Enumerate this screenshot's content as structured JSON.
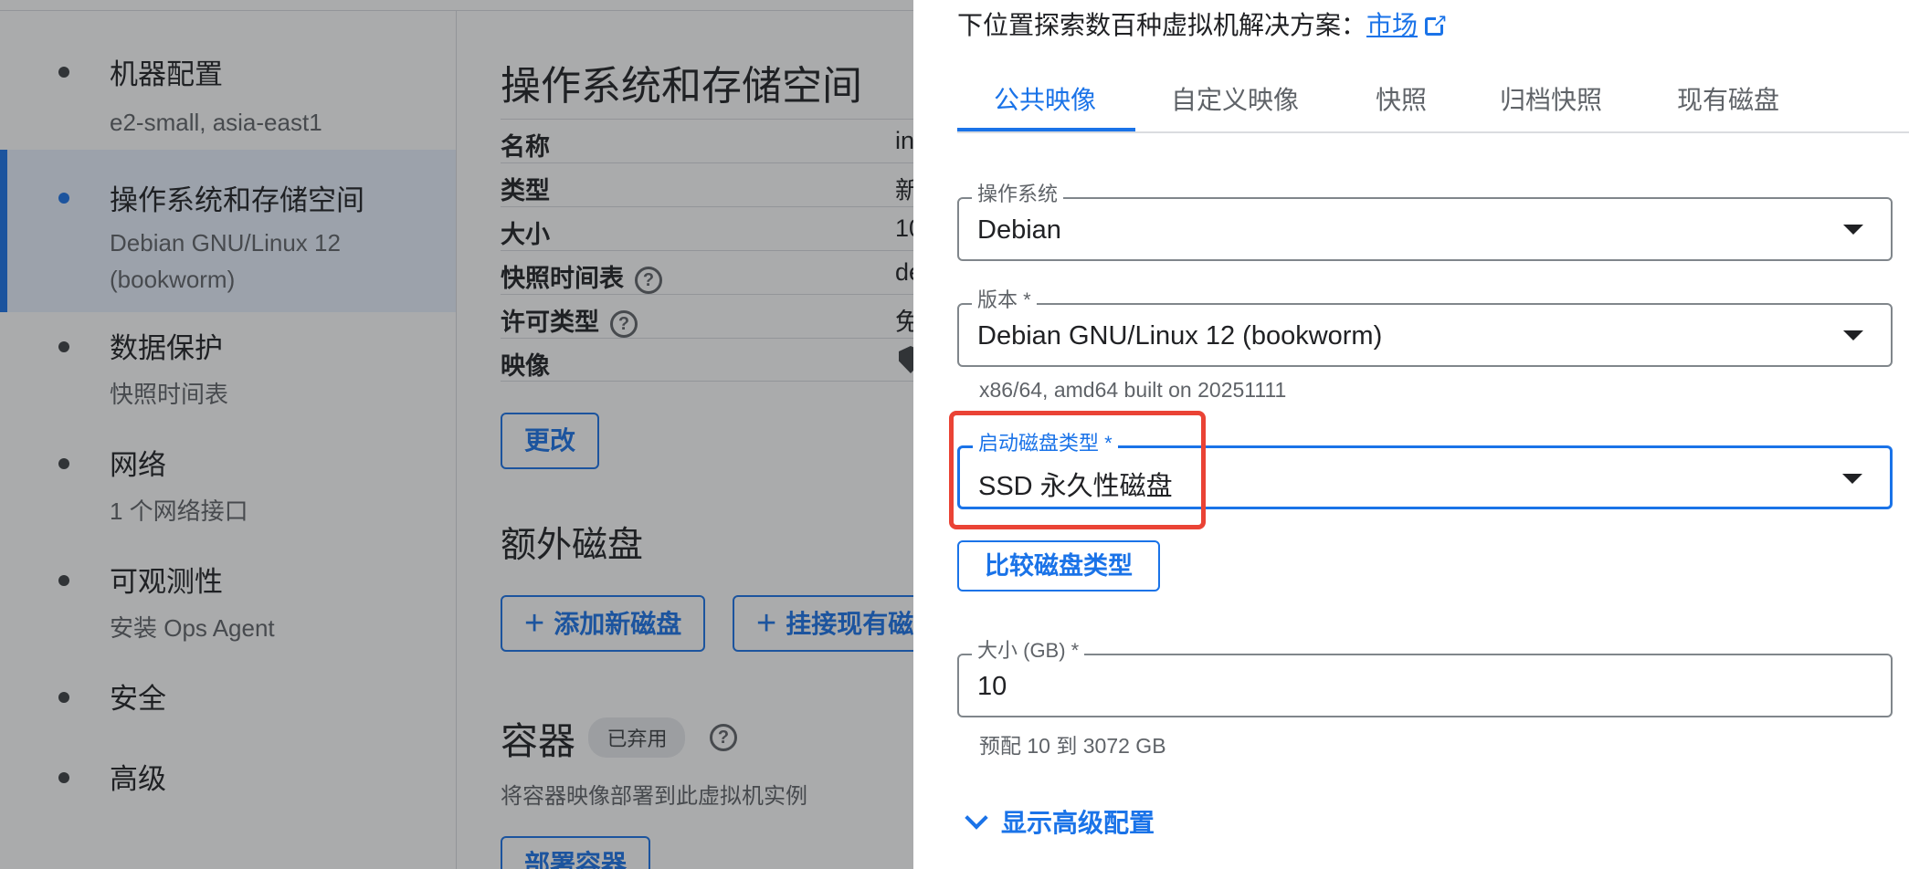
{
  "steps": [
    {
      "title": "机器配置",
      "sub": "e2-small, asia-east1"
    },
    {
      "title": "操作系统和存储空间",
      "sub": "Debian GNU/Linux 12 (bookworm)"
    },
    {
      "title": "数据保护",
      "sub": "快照时间表"
    },
    {
      "title": "网络",
      "sub": "1 个网络接口"
    },
    {
      "title": "可观测性",
      "sub": "安装 Ops Agent"
    },
    {
      "title": "安全",
      "sub": ""
    },
    {
      "title": "高级",
      "sub": ""
    }
  ],
  "main": {
    "os_storage_title": "操作系统和存储空间",
    "rows": [
      {
        "key": "名称",
        "value": "in"
      },
      {
        "key": "类型",
        "value": "新"
      },
      {
        "key": "大小",
        "value": "10"
      },
      {
        "key": "快照时间表",
        "value": "de"
      },
      {
        "key": "许可类型",
        "value": "免"
      },
      {
        "key": "映像",
        "value": ""
      }
    ],
    "change_button": "更改",
    "extra_disks_title": "额外磁盘",
    "add_disk_button": "添加新磁盘",
    "attach_disk_button": "挂接现有磁",
    "containers_title": "容器",
    "deprecated_chip": "已弃用",
    "containers_desc": "将容器映像部署到此虚拟机实例",
    "deploy_button": "部署容器"
  },
  "panel": {
    "intro_text": "下位置探索数百种虚拟机解决方案：",
    "marketplace_link": "市场",
    "tabs": [
      "公共映像",
      "自定义映像",
      "快照",
      "归档快照",
      "现有磁盘"
    ],
    "os_label": "操作系统",
    "os_value": "Debian",
    "version_label": "版本 *",
    "version_value": "Debian GNU/Linux 12 (bookworm)",
    "version_hint": "x86/64, amd64 built on 20251111",
    "disk_type_label": "启动磁盘类型 *",
    "disk_type_value": "SSD 永久性磁盘",
    "compare_button": "比较磁盘类型",
    "size_label": "大小 (GB) *",
    "size_value": "10",
    "size_hint": "预配 10 到 3072 GB",
    "advanced_link": "显示高级配置"
  },
  "colors": {
    "accent": "#1a73e8",
    "highlight": "#ea4335"
  }
}
